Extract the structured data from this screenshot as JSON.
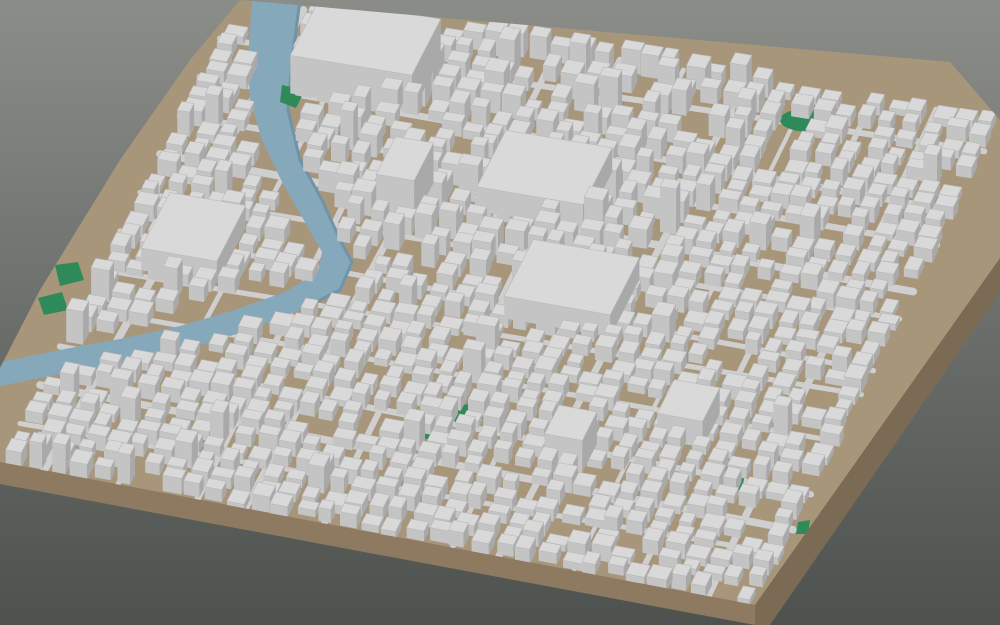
{
  "scene": {
    "type": "3d-city-block-model",
    "view": "isometric-perspective",
    "colors": {
      "background_top": "#8b8d89",
      "background_bottom": "#4d524f",
      "base_side": "#8e7a61",
      "base_side_dark": "#7b6a54",
      "ground": "#a8967b",
      "street": "#cfcfcf",
      "building_top": "#d9d9d9",
      "building_wall_light": "#c4c4c4",
      "building_wall_dark": "#a9a9a9",
      "water": "#86a8bb",
      "water_dark": "#6f94aa",
      "park": "#2f8a5a"
    },
    "features": [
      "river",
      "parks",
      "dense-building-blocks",
      "street-network",
      "terrain-base"
    ]
  }
}
